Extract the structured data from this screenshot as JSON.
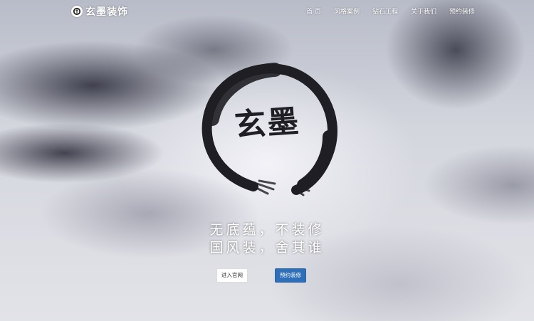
{
  "header": {
    "logo_text": "玄墨装饰"
  },
  "nav": {
    "items": [
      {
        "label": "首 页"
      },
      {
        "label": "风格案例"
      },
      {
        "label": "钻石工程"
      },
      {
        "label": "关于我们"
      },
      {
        "label": "预约装修"
      }
    ]
  },
  "hero": {
    "emblem_text": "玄墨",
    "slogan_line1": "无底蕴，不装修",
    "slogan_line2": "国风装，舍其谁",
    "buttons": {
      "enter_label": "进入官网",
      "book_label": "预约装修"
    }
  },
  "colors": {
    "primary_button": "#2f6fb8",
    "ink": "#1e1e24"
  }
}
